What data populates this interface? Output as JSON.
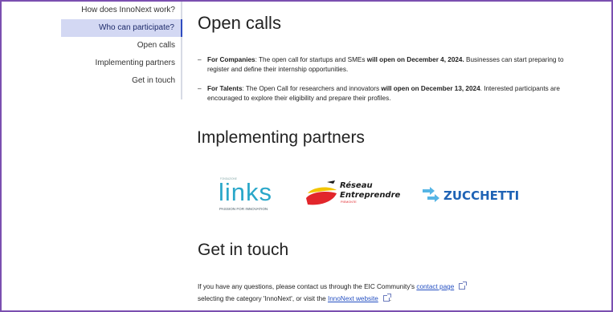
{
  "sidebar": {
    "items": [
      {
        "label": "How does InnoNext work?"
      },
      {
        "label": "Who can participate?"
      },
      {
        "label": "Open calls"
      },
      {
        "label": "Implementing partners"
      },
      {
        "label": "Get in touch"
      }
    ],
    "active_index": 1
  },
  "sections": {
    "open_calls": {
      "title": "Open calls",
      "items": [
        {
          "dash": "–",
          "label": "For Companies",
          "text_a": ": The open call for startups and SMEs ",
          "bold": "will open on December 4, 2024.",
          "text_b": " Businesses can start preparing to register and define their internship opportunities."
        },
        {
          "dash": "–",
          "label": "For Talents",
          "text_a": ": The Open Call for researchers and innovators ",
          "bold": "will open on December 13, 2024",
          "text_b": ". Interested participants are encouraged to explore their eligibility and prepare their profiles."
        }
      ]
    },
    "partners": {
      "title": "Implementing partners",
      "logos": {
        "links": {
          "top": "FONDAZIONE",
          "name": "links",
          "tagline": "PASSION FOR INNOVATION"
        },
        "reseau": {
          "line1": "Réseau",
          "line2": "Entreprendre",
          "region": "PIEMONTE"
        },
        "zucchetti": {
          "name": "ZUCCHETTI"
        }
      }
    },
    "touch": {
      "title": "Get in touch",
      "text_a": "If you have any questions, please contact us through the EIC Community's ",
      "link1": "contact page",
      "text_b": "selecting the category 'InnoNext', or visit the ",
      "link2": "InnoNext website",
      "text_c": "."
    }
  },
  "colors": {
    "frame": "#7b4fb0",
    "active_bg": "#d3d8f3",
    "link": "#2550c2",
    "links_logo": "#2aa7c9",
    "reseau_red": "#e2262b",
    "reseau_yellow": "#f2c500",
    "zucchetti_blue": "#1f63b5",
    "zucchetti_light": "#56b5e5"
  }
}
